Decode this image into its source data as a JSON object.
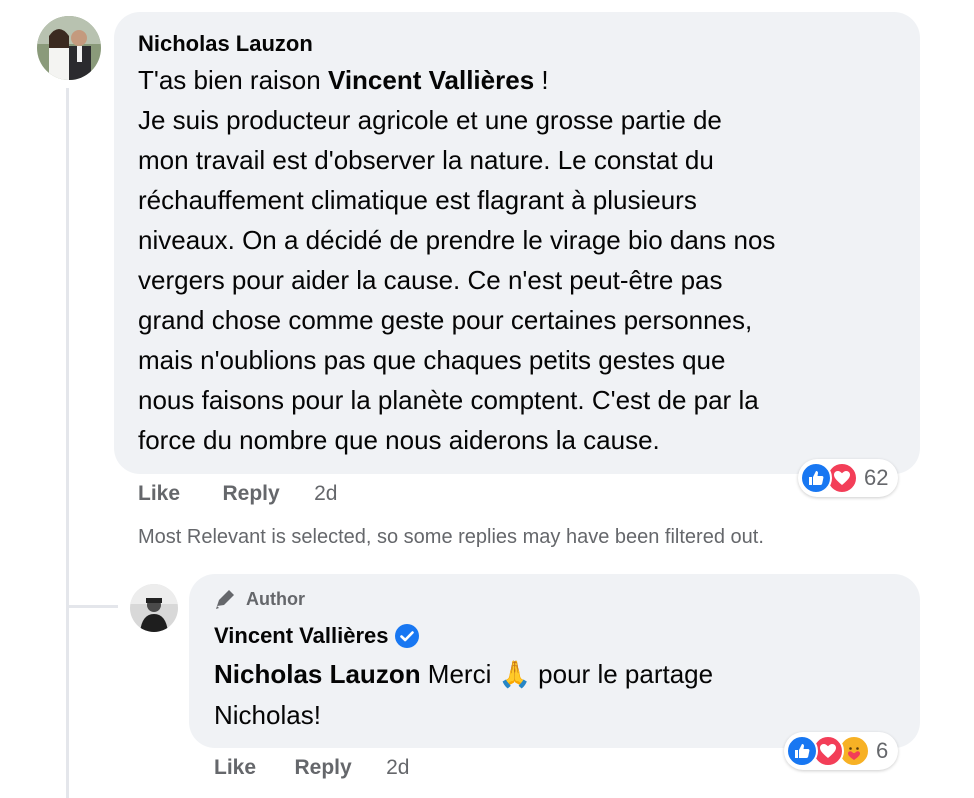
{
  "comment": {
    "author": "Nicholas Lauzon",
    "mention": "Vincent Vallières",
    "text_after_mention": " !",
    "text_prefix": "T'as bien raison ",
    "lines": [
      "Je suis producteur agricole et une grosse partie de",
      "mon travail est d'observer la nature. Le constat du",
      "réchauffement climatique est flagrant à plusieurs",
      "niveaux. On a décidé de prendre le virage bio dans nos",
      "vergers pour aider la cause. Ce n'est peut-être pas",
      "grand chose comme geste pour certaines personnes,",
      "mais n'oublions pas que chaques petits gestes que",
      "nous faisons pour la planète comptent. C'est de par la",
      "force du nombre que nous aiderons la cause."
    ],
    "reaction_count": "62",
    "reaction_icons": [
      "like-icon",
      "love-icon"
    ],
    "actions": {
      "like": "Like",
      "reply": "Reply",
      "time": "2d"
    }
  },
  "filter_note": "Most Relevant is selected, so some replies may have been filtered out.",
  "reply": {
    "badge": "Author",
    "author": "Vincent Vallières",
    "verified": true,
    "mention": "Nicholas Lauzon",
    "text_line1": " Merci ",
    "emoji": "🙏",
    "text_line1_end": " pour le partage",
    "text_line2": "Nicholas!",
    "reaction_count": "6",
    "reaction_icons": [
      "like-icon",
      "love-icon",
      "care-icon"
    ],
    "actions": {
      "like": "Like",
      "reply": "Reply",
      "time": "2d"
    }
  },
  "colors": {
    "bubble": "#f0f2f5",
    "secondary_text": "#65676b",
    "like_blue": "#1877f2",
    "love_red": "#f33e58",
    "care_yellow": "#f7b125",
    "verified_blue": "#1877f2"
  }
}
